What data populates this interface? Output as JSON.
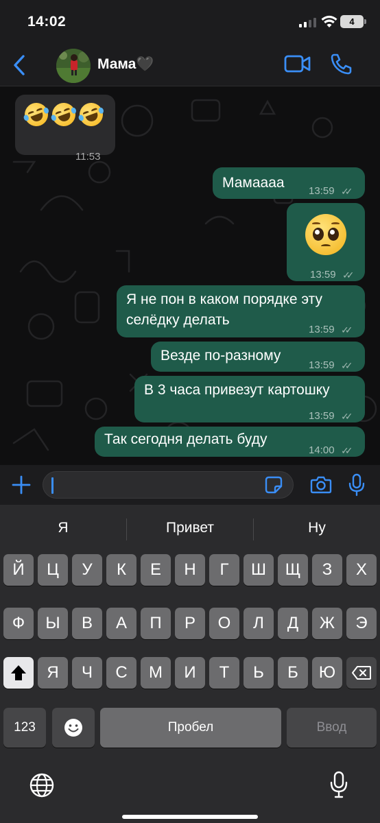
{
  "status_bar": {
    "time": "14:02",
    "battery": "4",
    "icons": [
      "signal-icon",
      "wifi-icon",
      "battery-icon"
    ]
  },
  "header": {
    "contact_name": "Мама🖤",
    "icons": [
      "back-icon",
      "avatar",
      "video-call-icon",
      "phone-call-icon"
    ],
    "accent_color": "#3a8ef6"
  },
  "messages": [
    {
      "direction": "in",
      "text": "🤣🤣🤣",
      "time": "11:53"
    },
    {
      "direction": "out",
      "text": "Мамаааа",
      "time": "13:59",
      "read": true
    },
    {
      "direction": "out",
      "text": "🥺",
      "time": "13:59",
      "read": true
    },
    {
      "direction": "out",
      "text_lines": [
        "Я не пон в каком порядке эту",
        "селёдку делать"
      ],
      "time": "13:59",
      "read": true
    },
    {
      "direction": "out",
      "text": "Везде по-разному",
      "time": "13:59",
      "read": true
    },
    {
      "direction": "out",
      "text": "В 3 часа привезут картошку",
      "time": "13:59",
      "read": true
    },
    {
      "direction": "out",
      "text": "Так сегодня делать буду",
      "time": "14:00",
      "read": true
    }
  ],
  "colors": {
    "outgoing_bubble": "#1f5b4a",
    "incoming_bubble": "#2b2b2d",
    "accent": "#3a8ef6"
  },
  "input": {
    "value": "",
    "icons": [
      "plus-icon",
      "sticker-icon",
      "camera-icon",
      "microphone-icon"
    ]
  },
  "keyboard": {
    "suggestions": [
      "Я",
      "Привет",
      "Ну"
    ],
    "row1": [
      "Й",
      "Ц",
      "У",
      "К",
      "Е",
      "Н",
      "Г",
      "Ш",
      "Щ",
      "З",
      "Х"
    ],
    "row2": [
      "Ф",
      "Ы",
      "В",
      "А",
      "П",
      "Р",
      "О",
      "Л",
      "Д",
      "Ж",
      "Э"
    ],
    "row3": [
      "Я",
      "Ч",
      "С",
      "М",
      "И",
      "Т",
      "Ь",
      "Б",
      "Ю"
    ],
    "numbers_key": "123",
    "space_key": "Пробел",
    "return_key": "Ввод",
    "icons": [
      "shift-icon",
      "backspace-icon",
      "emoji-icon",
      "globe-icon",
      "dictation-icon"
    ]
  }
}
